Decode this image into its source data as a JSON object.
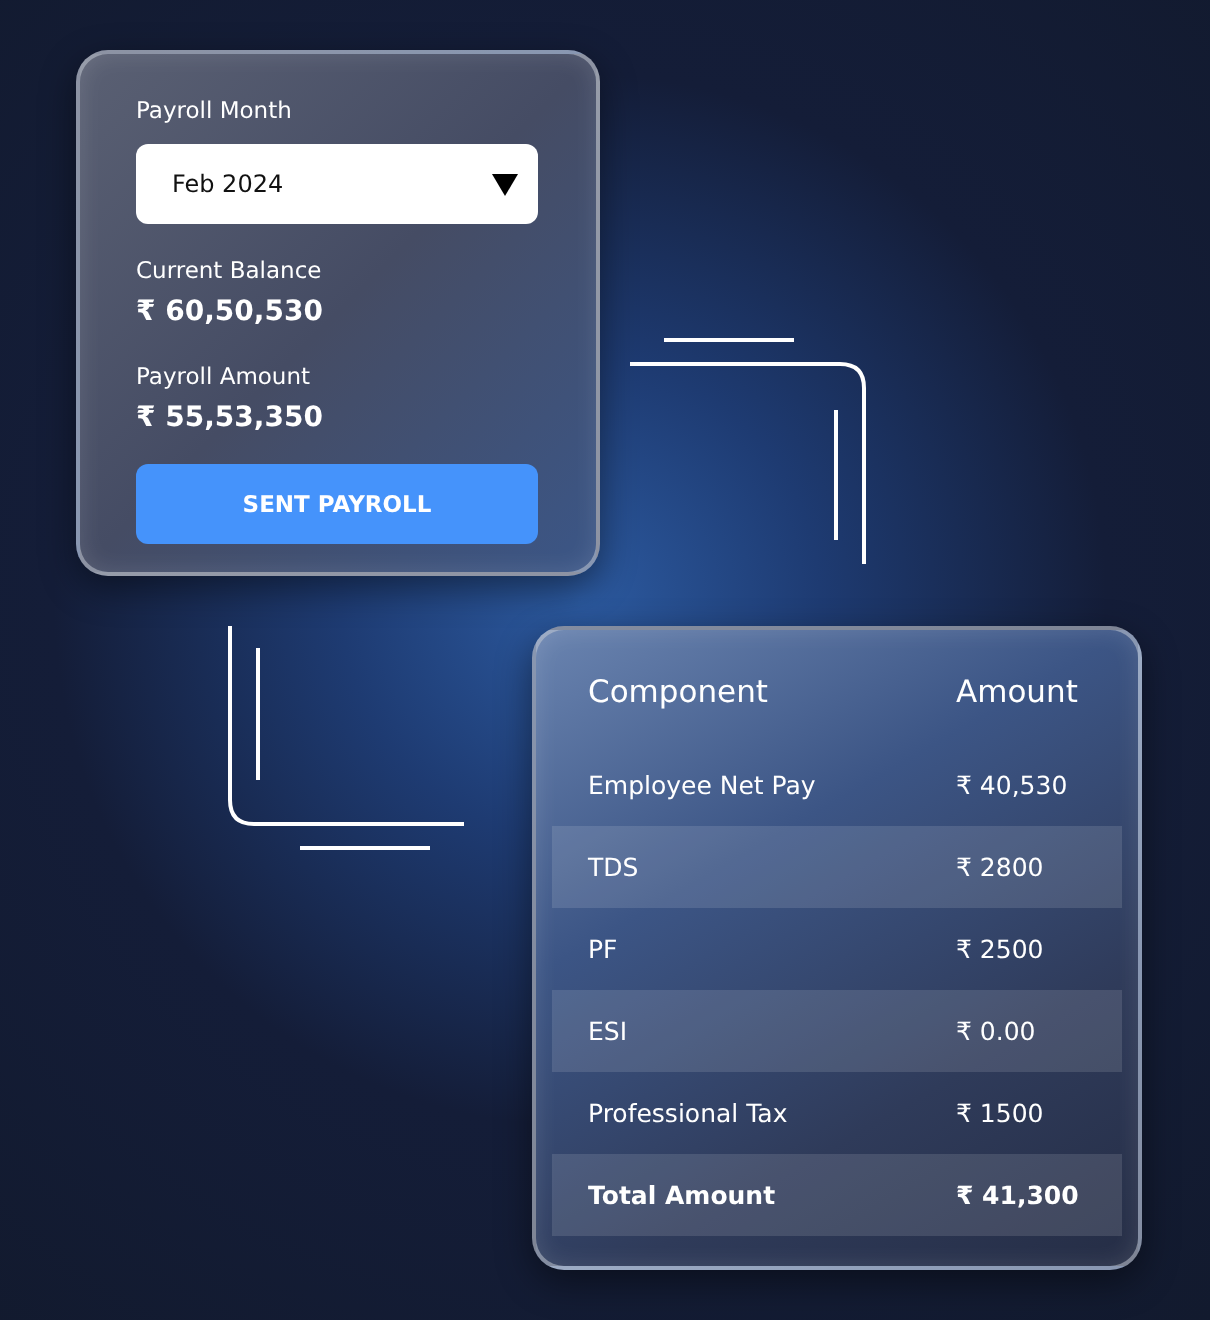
{
  "payroll_card": {
    "month_label": "Payroll Month",
    "month_select": {
      "value": "Feb 2024"
    },
    "balance_label": "Current Balance",
    "balance_value": "₹ 60,50,530",
    "amount_label": "Payroll Amount",
    "amount_value": "₹ 55,53,350",
    "button": "SENT PAYROLL"
  },
  "components_table": {
    "columns": [
      "Component",
      "Amount"
    ],
    "rows": [
      {
        "kind": "item",
        "component": "Employee Net Pay",
        "amount": "₹ 40,530"
      },
      {
        "kind": "item",
        "component": "TDS",
        "amount": "₹ 2800"
      },
      {
        "kind": "item",
        "component": "PF",
        "amount": "₹ 2500"
      },
      {
        "kind": "item",
        "component": "ESI",
        "amount": "₹ 0.00"
      },
      {
        "kind": "item",
        "component": "Professional Tax",
        "amount": "₹ 1500"
      },
      {
        "kind": "total",
        "component": "Total Amount",
        "amount": "₹ 41,300"
      }
    ]
  }
}
